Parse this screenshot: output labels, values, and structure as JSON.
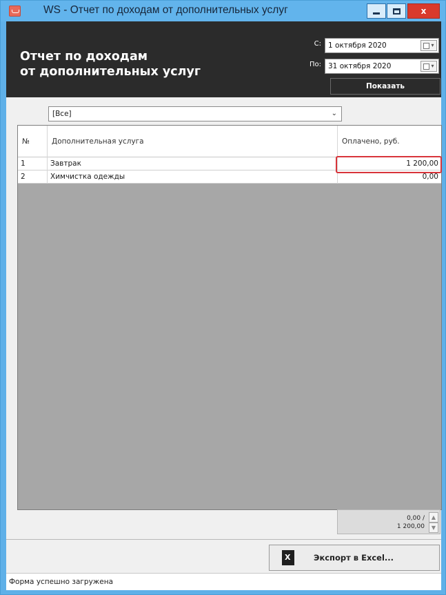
{
  "window": {
    "title": "WS - Отчет по доходам от дополнительных услуг",
    "minimize_icon": "minimize-icon",
    "maximize_icon": "maximize-icon",
    "close_icon": "close-icon",
    "close_glyph": "x"
  },
  "header": {
    "title_line1": "Отчет по доходам",
    "title_line2": "от дополнительных услуг",
    "from_label": "С:",
    "from_value": "1 октября 2020",
    "to_label": "По:",
    "to_value": "31 октября 2020",
    "show_button": "Показать"
  },
  "filter": {
    "selected": "[Все]"
  },
  "table": {
    "columns": [
      "№",
      "Дополнительная услуга",
      "Оплачено, руб."
    ],
    "rows": [
      {
        "num": "1",
        "service": "Завтрак",
        "paid": "1 200,00"
      },
      {
        "num": "2",
        "service": "Химчистка одежды",
        "paid": "0,00"
      }
    ]
  },
  "totals": {
    "line1": "0,00 /",
    "line2": "1 200,00"
  },
  "footer": {
    "export_button": "Экспорт в Excel...",
    "status": "Форма успешно загружена"
  },
  "colors": {
    "titlebar": "#62b4ec",
    "header_bg": "#2b2b2b",
    "grid_bg": "#a7a7a7",
    "highlight": "#d8343a"
  }
}
